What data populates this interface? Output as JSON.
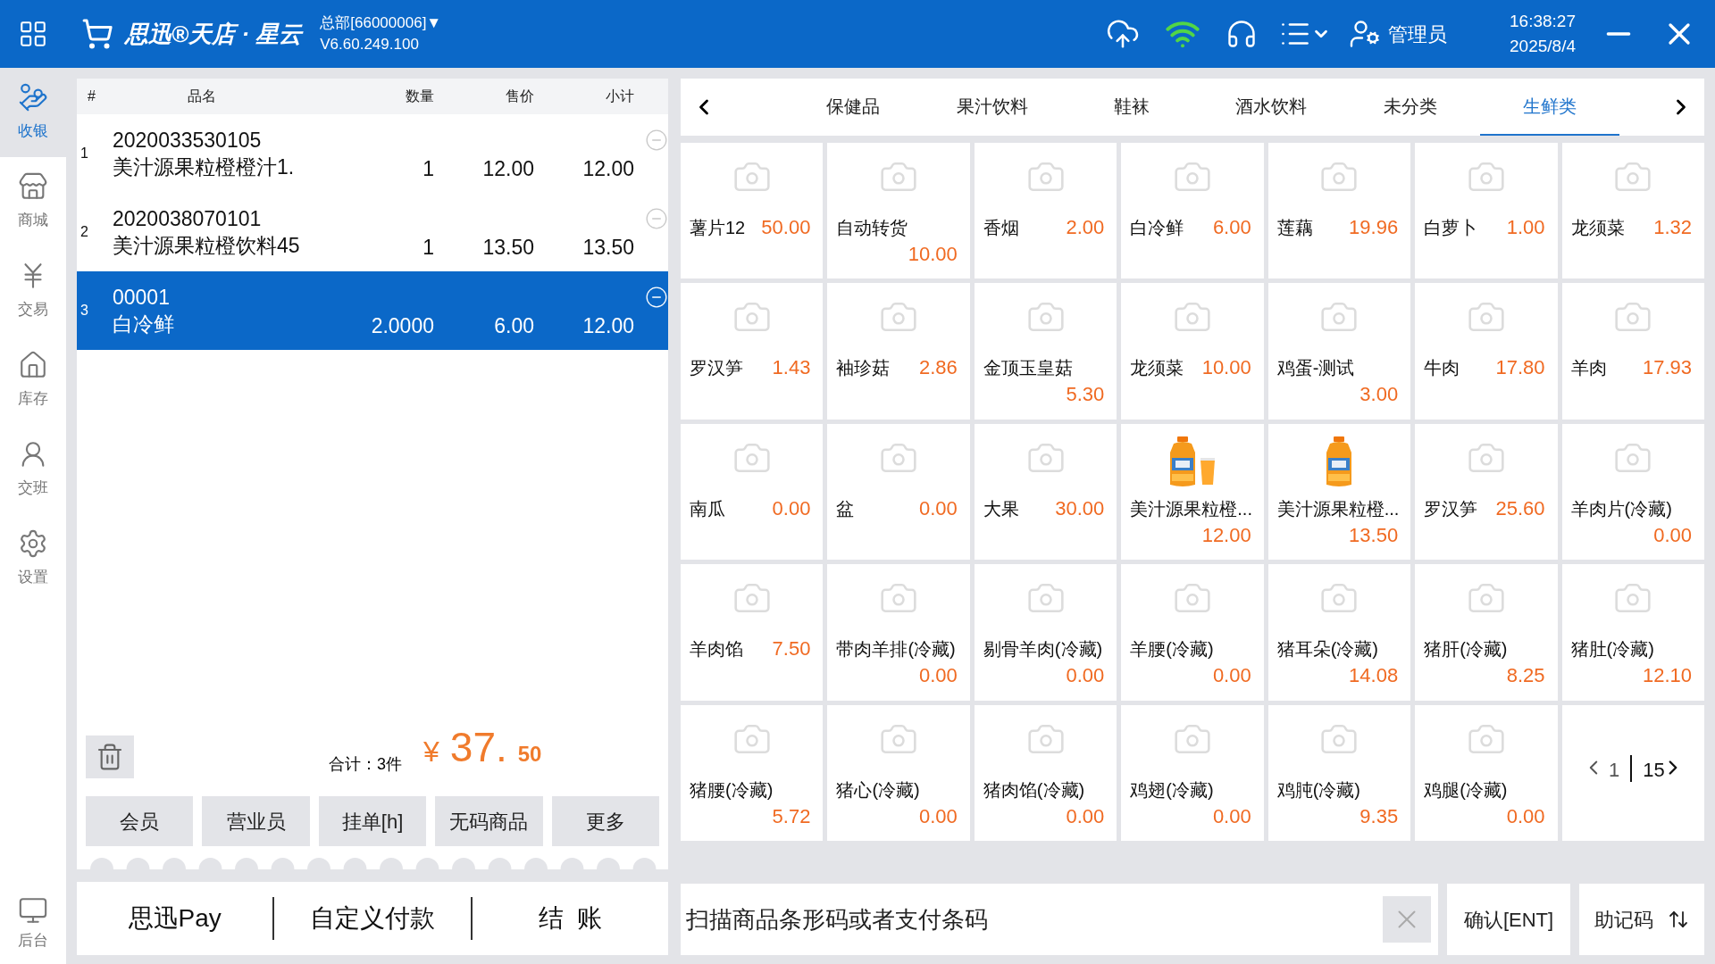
{
  "top_bar": {
    "logo": "思迅®天店 · 星云",
    "store": "总部[66000006]▼",
    "version": "V6.60.249.100",
    "user": "管理员",
    "time": "16:38:27",
    "date": "2025/8/4"
  },
  "sidebar": {
    "items": [
      {
        "label": "收银",
        "selected": true
      },
      {
        "label": "商城",
        "selected": false
      },
      {
        "label": "交易",
        "selected": false
      },
      {
        "label": "库存",
        "selected": false
      },
      {
        "label": "交班",
        "selected": false
      },
      {
        "label": "设置",
        "selected": false
      }
    ],
    "bottom_item": "后台"
  },
  "cart": {
    "columns": [
      "#",
      "品名",
      "数量",
      "售价",
      "小计"
    ],
    "rows": [
      {
        "index": "1",
        "code": "2020033530105",
        "name": "美汁源果粒橙橙汁1.",
        "qty": "1",
        "price": "12.00",
        "subtotal": "12.00",
        "selected": false
      },
      {
        "index": "2",
        "code": "2020038070101",
        "name": "美汁源果粒橙饮料45",
        "qty": "1",
        "price": "13.50",
        "subtotal": "13.50",
        "selected": false
      },
      {
        "index": "3",
        "code": "00001",
        "name": "白冷鲜",
        "qty": "2.0000",
        "price": "6.00",
        "subtotal": "12.00",
        "selected": true
      }
    ]
  },
  "summary": {
    "count": "合计：3件",
    "currency": "¥",
    "amount": "37.",
    "cents": "50"
  },
  "actions": [
    "会员",
    "营业员",
    "挂单[h]",
    "无码商品",
    "更多"
  ],
  "payment": [
    "思迅Pay",
    "自定义付款",
    "结  账"
  ],
  "categories": [
    {
      "label": "保健品",
      "selected": false
    },
    {
      "label": "果汁饮料",
      "selected": false
    },
    {
      "label": "鞋袜",
      "selected": false
    },
    {
      "label": "酒水饮料",
      "selected": false
    },
    {
      "label": "未分类",
      "selected": false
    },
    {
      "label": "生鲜类",
      "selected": true
    }
  ],
  "products": [
    {
      "name": "薯片12",
      "price": "50.00",
      "kind": "camera"
    },
    {
      "name": "自动转货",
      "price": "10.00",
      "kind": "camera"
    },
    {
      "name": "香烟",
      "price": "2.00",
      "kind": "camera"
    },
    {
      "name": "白冷鲜",
      "price": "6.00",
      "kind": "camera"
    },
    {
      "name": "莲藕",
      "price": "19.96",
      "kind": "camera"
    },
    {
      "name": "白萝卜",
      "price": "1.00",
      "kind": "camera"
    },
    {
      "name": "龙须菜",
      "price": "1.32",
      "kind": "camera"
    },
    {
      "name": "罗汉笋",
      "price": "1.43",
      "kind": "camera"
    },
    {
      "name": "袖珍菇",
      "price": "2.86",
      "kind": "camera"
    },
    {
      "name": "金顶玉皇菇",
      "price": "5.30",
      "kind": "camera"
    },
    {
      "name": "龙须菜",
      "price": "10.00",
      "kind": "camera"
    },
    {
      "name": "鸡蛋-测试",
      "price": "3.00",
      "kind": "camera"
    },
    {
      "name": "牛肉",
      "price": "17.80",
      "kind": "camera"
    },
    {
      "name": "羊肉",
      "price": "17.93",
      "kind": "camera"
    },
    {
      "name": "南瓜",
      "price": "0.00",
      "kind": "camera"
    },
    {
      "name": "盆",
      "price": "0.00",
      "kind": "camera"
    },
    {
      "name": "大果",
      "price": "30.00",
      "kind": "camera"
    },
    {
      "name": "美汁源果粒橙...",
      "price": "12.00",
      "kind": "picture"
    },
    {
      "name": "美汁源果粒橙...",
      "price": "13.50",
      "kind": "picture"
    },
    {
      "name": "罗汉笋",
      "price": "25.60",
      "kind": "camera"
    },
    {
      "name": "羊肉片(冷藏)",
      "price": "0.00",
      "kind": "camera"
    },
    {
      "name": "羊肉馅",
      "price": "7.50",
      "kind": "camera"
    },
    {
      "name": "带肉羊排(冷藏)",
      "price": "0.00",
      "kind": "camera"
    },
    {
      "name": "剔骨羊肉(冷藏)",
      "price": "0.00",
      "kind": "camera"
    },
    {
      "name": "羊腰(冷藏)",
      "price": "0.00",
      "kind": "camera"
    },
    {
      "name": "猪耳朵(冷藏)",
      "price": "14.08",
      "kind": "camera"
    },
    {
      "name": "猪肝(冷藏)",
      "price": "8.25",
      "kind": "camera"
    },
    {
      "name": "猪肚(冷藏)",
      "price": "12.10",
      "kind": "camera"
    },
    {
      "name": "猪腰(冷藏)",
      "price": "5.72",
      "kind": "camera"
    },
    {
      "name": "猪心(冷藏)",
      "price": "0.00",
      "kind": "camera"
    },
    {
      "name": "猪肉馅(冷藏)",
      "price": "0.00",
      "kind": "camera"
    },
    {
      "name": "鸡翅(冷藏)",
      "price": "0.00",
      "kind": "camera"
    },
    {
      "name": "鸡肫(冷藏)",
      "price": "9.35",
      "kind": "camera"
    },
    {
      "name": "鸡腿(冷藏)",
      "price": "0.00",
      "kind": "camera"
    }
  ],
  "pagination": {
    "current": "1",
    "total": "15"
  },
  "scan": {
    "placeholder": "扫描商品条形码或者支付条码",
    "confirm": "确认[ENT]",
    "mnemonic": "助记码"
  }
}
